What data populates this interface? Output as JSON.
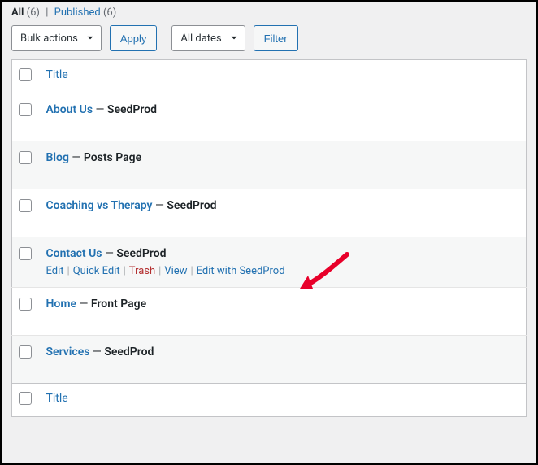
{
  "filters": {
    "all_label": "All",
    "all_count": "(6)",
    "published_label": "Published",
    "published_count": "(6)"
  },
  "bulk": {
    "label": "Bulk actions",
    "apply": "Apply"
  },
  "date": {
    "label": "All dates",
    "filter": "Filter"
  },
  "columns": {
    "title": "Title"
  },
  "rows": [
    {
      "title": "About Us",
      "state": "SeedProd"
    },
    {
      "title": "Blog",
      "state": "Posts Page"
    },
    {
      "title": "Coaching vs Therapy",
      "state": "SeedProd"
    },
    {
      "title": "Contact Us",
      "state": "SeedProd",
      "show_actions": true
    },
    {
      "title": "Home",
      "state": "Front Page"
    },
    {
      "title": "Services",
      "state": "SeedProd"
    }
  ],
  "actions": {
    "edit": "Edit",
    "quick_edit": "Quick Edit",
    "trash": "Trash",
    "view": "View",
    "edit_seedprod": "Edit with SeedProd"
  }
}
